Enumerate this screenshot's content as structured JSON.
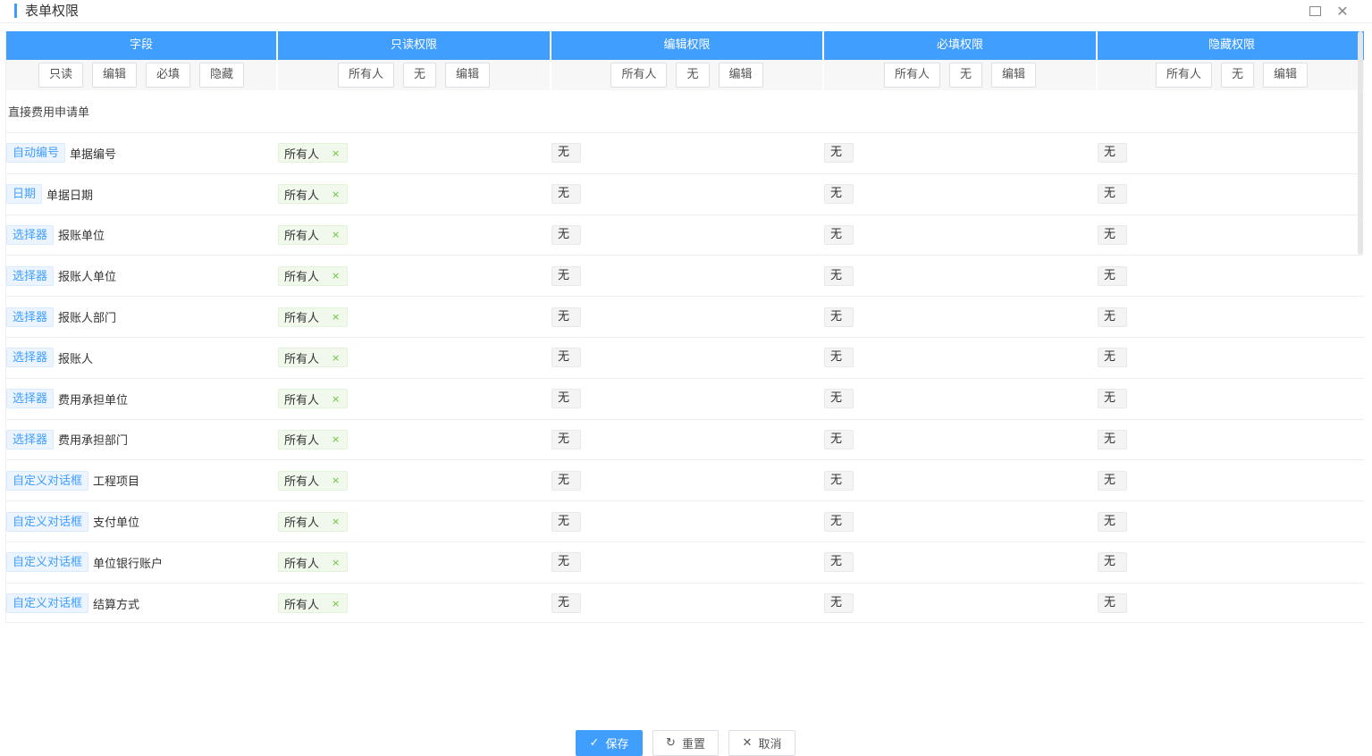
{
  "dialog": {
    "title": "表单权限",
    "maximize_label": "",
    "close_glyph": "✕"
  },
  "columns": [
    {
      "label": "字段",
      "buttons": [
        "只读",
        "编辑",
        "必填",
        "隐藏"
      ]
    },
    {
      "label": "只读权限",
      "buttons": [
        "所有人",
        "无",
        "编辑"
      ]
    },
    {
      "label": "编辑权限",
      "buttons": [
        "所有人",
        "无",
        "编辑"
      ]
    },
    {
      "label": "必填权限",
      "buttons": [
        "所有人",
        "无",
        "编辑"
      ]
    },
    {
      "label": "隐藏权限",
      "buttons": [
        "所有人",
        "无",
        "编辑"
      ]
    }
  ],
  "group_label": "直接费用申请单",
  "tags": {
    "all": "所有人",
    "none": "无",
    "remove": "×"
  },
  "rows": [
    {
      "type": "自动编号",
      "name": "单据编号"
    },
    {
      "type": "日期",
      "name": "单据日期"
    },
    {
      "type": "选择器",
      "name": "报账单位"
    },
    {
      "type": "选择器",
      "name": "报账人单位"
    },
    {
      "type": "选择器",
      "name": "报账人部门"
    },
    {
      "type": "选择器",
      "name": "报账人"
    },
    {
      "type": "选择器",
      "name": "费用承担单位"
    },
    {
      "type": "选择器",
      "name": "费用承担部门"
    },
    {
      "type": "自定义对话框",
      "name": "工程项目"
    },
    {
      "type": "自定义对话框",
      "name": "支付单位"
    },
    {
      "type": "自定义对话框",
      "name": "单位银行账户"
    },
    {
      "type": "自定义对话框",
      "name": "结算方式"
    }
  ],
  "footer": {
    "save": "保存",
    "save_icon": "✓",
    "reset": "重置",
    "reset_icon": "↻",
    "cancel": "取消",
    "cancel_icon": "✕"
  },
  "colors": {
    "accent": "#409eff",
    "tag_green_bg": "#f0f9eb",
    "tag_blue_bg": "#ecf5ff"
  }
}
